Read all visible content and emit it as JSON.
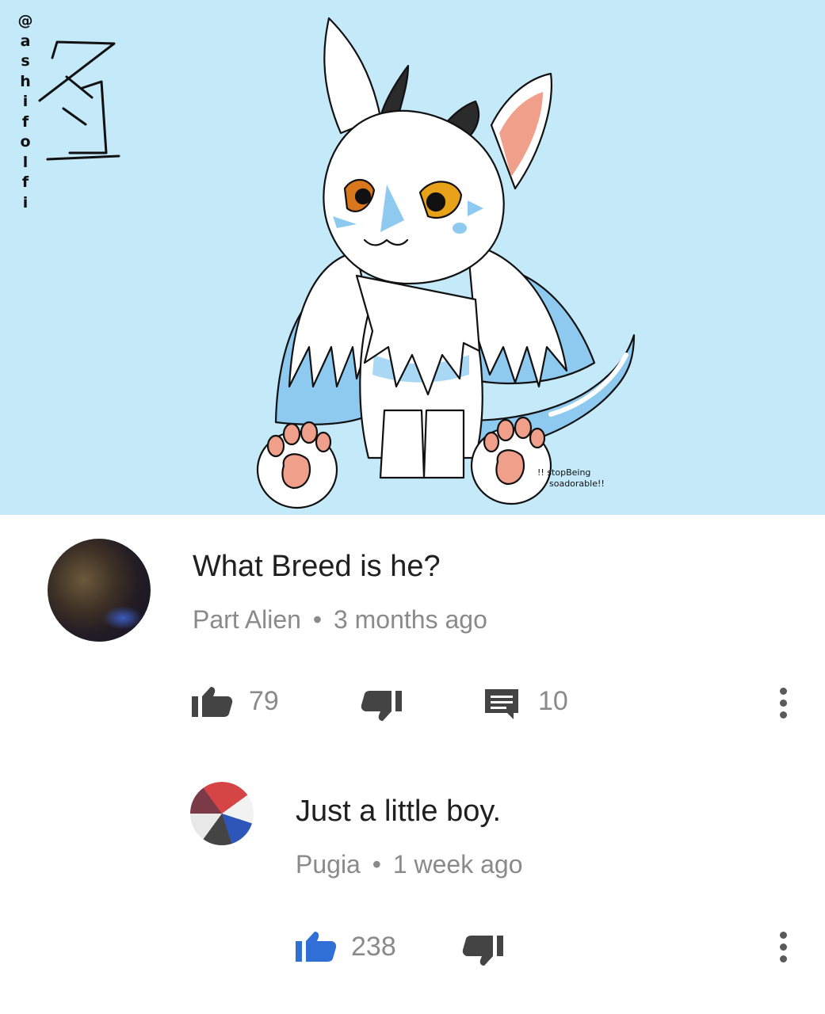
{
  "artwork": {
    "handle_chars": [
      "@",
      "a",
      "s",
      "h",
      "i",
      "f",
      "o",
      "l",
      "f",
      "i"
    ],
    "caption_line1": "!! stopBeing",
    "caption_line2": "soadorable!!",
    "background_color": "#c4e9f8"
  },
  "comment": {
    "text": "What Breed is he?",
    "author": "Part Alien",
    "separator": "•",
    "time": "3 months ago",
    "likes": "79",
    "replies": "10",
    "like_icon": "thumbs-up-icon",
    "dislike_icon": "thumbs-down-icon",
    "reply_icon": "comment-icon",
    "menu_icon": "more-vertical-icon"
  },
  "reply": {
    "text": "Just a little boy.",
    "author": "Pugia",
    "separator": "•",
    "time": "1 week ago",
    "likes": "238",
    "like_icon": "thumbs-up-icon",
    "dislike_icon": "thumbs-down-icon",
    "menu_icon": "more-vertical-icon",
    "liked": true,
    "accent_color": "#2f6fd6"
  }
}
